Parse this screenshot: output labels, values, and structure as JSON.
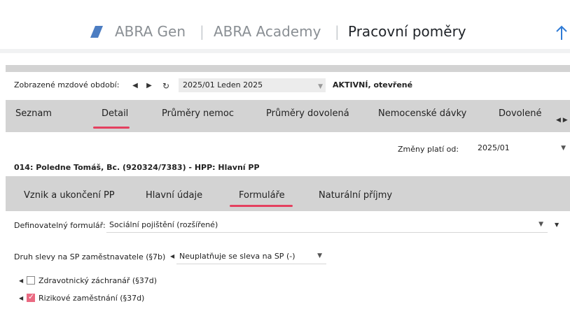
{
  "header": {
    "brand": "ABRA Gen",
    "separator": "|",
    "academy": "ABRA Academy",
    "title": "Pracovní poměry",
    "brand_color": "#4c7dc2",
    "up_icon": "arrow-up-icon"
  },
  "period": {
    "label": "Zobrazené mzdové období:",
    "value": "2025/01 Leden 2025",
    "status": "AKTIVNÍ, otevřené"
  },
  "tabs": [
    {
      "label": "Seznam",
      "active": false
    },
    {
      "label": "Detail",
      "active": true
    },
    {
      "label": "Průměry nemoc",
      "active": false
    },
    {
      "label": "Průměry dovolená",
      "active": false
    },
    {
      "label": "Nemocenské dávky",
      "active": false
    },
    {
      "label": "Dovolené",
      "active": false
    }
  ],
  "employee": {
    "changes_label": "Změny platí od:",
    "changes_value": "2025/01",
    "name": "014: Poledne Tomáš, Bc. (920324/7383) - HPP: Hlavní PP"
  },
  "subtabs": [
    {
      "label": "Vznik a ukončení PP",
      "active": false
    },
    {
      "label": "Hlavní údaje",
      "active": false
    },
    {
      "label": "Formuláře",
      "active": true
    },
    {
      "label": "Naturální příjmy",
      "active": false
    }
  ],
  "form": {
    "definable_label": "Definovatelný formulář:",
    "definable_value": "Sociální pojištění (rozšířené)",
    "discount_label": "Druh slevy na SP zaměstnavatele (§7b)",
    "discount_value": "Neuplatňuje se sleva na SP (-)",
    "checkbox1_label": "Zdravotnický záchranář (§37d)",
    "checkbox1_checked": false,
    "checkbox2_label": "Rizikové zaměstnání (§37d)",
    "checkbox2_checked": true
  },
  "colors": {
    "accent": "#e4405f",
    "check": "#ea6a82",
    "tab_bg": "#d3d3d3"
  }
}
